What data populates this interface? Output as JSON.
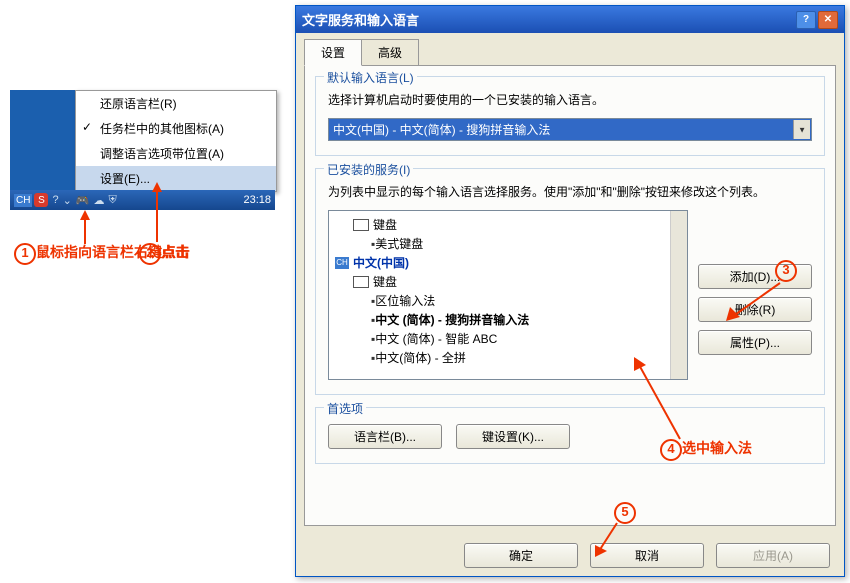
{
  "context_menu": {
    "items": [
      {
        "label": "还原语言栏(R)",
        "checked": false
      },
      {
        "label": "任务栏中的其他图标(A)",
        "checked": true
      },
      {
        "label": "调整语言选项带位置(A)",
        "checked": false
      },
      {
        "label": "设置(E)...",
        "checked": false,
        "highlighted": true
      }
    ]
  },
  "taskbar": {
    "ch": "CH",
    "sogou": "S",
    "time": "23:18"
  },
  "annotations": {
    "a1": "鼠标指向语言栏右键点击",
    "a2": "点击",
    "a3_num": "3",
    "a4": "选中输入法",
    "a5_num": "5"
  },
  "dialog": {
    "title": "文字服务和输入语言",
    "tabs": [
      "设置",
      "高级"
    ],
    "default_lang": {
      "legend": "默认输入语言(L)",
      "text": "选择计算机启动时要使用的一个已安装的输入语言。",
      "value": "中文(中国) - 中文(简体) - 搜狗拼音输入法"
    },
    "services": {
      "legend": "已安装的服务(I)",
      "text": "为列表中显示的每个输入语言选择服务。使用\"添加\"和\"删除\"按钮来修改这个列表。",
      "kb_label": "键盘",
      "us_kb": "美式键盘",
      "ch_cn": "中文(中国)",
      "ime1": "区位输入法",
      "ime2": "中文 (简体) - 搜狗拼音输入法",
      "ime3": "中文 (简体) - 智能 ABC",
      "ime4": "中文(简体) - 全拼",
      "btn_add": "添加(D)...",
      "btn_remove": "删除(R)",
      "btn_props": "属性(P)..."
    },
    "prefs": {
      "legend": "首选项",
      "btn_lang": "语言栏(B)...",
      "btn_key": "键设置(K)..."
    },
    "footer": {
      "ok": "确定",
      "cancel": "取消",
      "apply": "应用(A)"
    }
  }
}
